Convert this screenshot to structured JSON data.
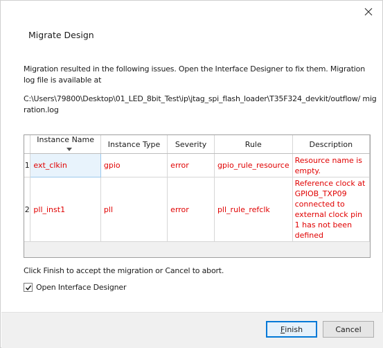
{
  "dialog": {
    "title": "Migrate Design",
    "message": "Migration resulted in the following issues. Open the Interface Designer to fix them. Migration log file is available at",
    "log_path": "C:\\Users\\79800\\Desktop\\01_LED_8bit_Test\\ip\\jtag_spi_flash_loader\\T35F324_devkit/outflow/ migration.log",
    "footer_text": "Click Finish to accept the migration or Cancel to abort.",
    "checkbox": {
      "label": "Open Interface Designer",
      "checked": true
    }
  },
  "table": {
    "columns": [
      "Instance Name",
      "Instance Type",
      "Severity",
      "Rule",
      "Description"
    ],
    "sorted_column": "Instance Name",
    "rows": [
      {
        "index": "1",
        "instance_name": "ext_clkin",
        "instance_type": "gpio",
        "severity": "error",
        "rule": "gpio_rule_resource",
        "description": "Resource name is empty."
      },
      {
        "index": "2",
        "instance_name": "pll_inst1",
        "instance_type": "pll",
        "severity": "error",
        "rule": "pll_rule_refclk",
        "description": "Reference clock at GPIOB_TXP09 connected to external clock pin 1 has not been defined"
      }
    ]
  },
  "buttons": {
    "finish_mnemonic": "F",
    "finish_rest": "inish",
    "cancel": "Cancel"
  },
  "colors": {
    "error_text": "#e00000",
    "accent": "#0078d7"
  },
  "icons": {
    "close": "close-icon",
    "check": "checkmark-icon",
    "sort": "sort-down-icon"
  }
}
